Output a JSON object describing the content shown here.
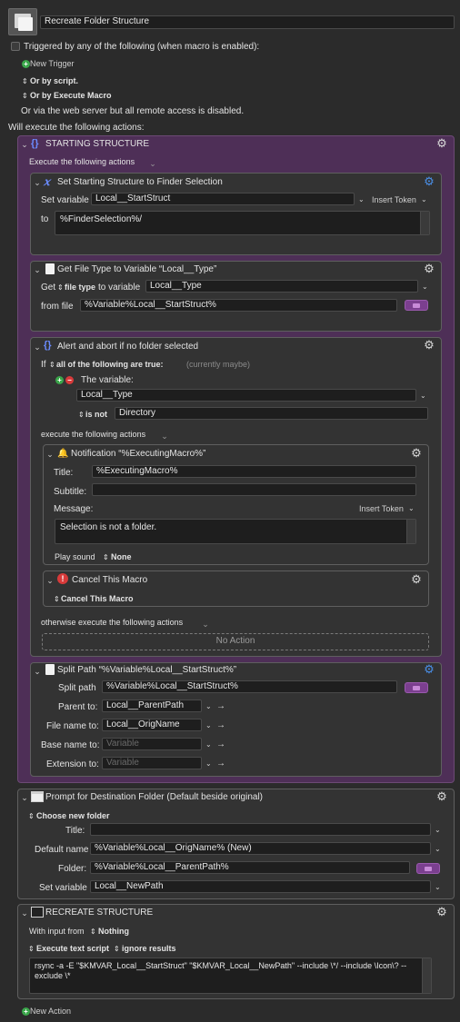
{
  "macro_name": "Recreate Folder Structure",
  "trigger": {
    "checkbox_label": "Triggered by any of the following (when macro is enabled):",
    "new_trigger": "New Trigger",
    "or_by_script": "Or by script.",
    "or_by_execute": "Or by Execute Macro",
    "web_server": "Or via the web server but all remote access is disabled."
  },
  "will_execute": "Will execute the following actions:",
  "group_starting": {
    "title": "STARTING STRUCTURE",
    "execute_label": "Execute the following actions"
  },
  "set_var": {
    "title": "Set Starting Structure to Finder Selection",
    "set_variable_label": "Set variable",
    "variable": "Local__StartStruct",
    "insert_token": "Insert Token",
    "to_label": "to",
    "value": "%FinderSelection%/"
  },
  "get_file_type": {
    "title": "Get File Type to Variable “Local__Type”",
    "get_label": "Get",
    "file_type": "file type",
    "to_variable_label": "to variable",
    "variable": "Local__Type",
    "from_file_label": "from file",
    "from_file": "%Variable%Local__StartStruct%"
  },
  "if_block": {
    "title": "Alert and abort if no folder selected",
    "if_label": "If",
    "condition": "all of the following are true:",
    "currently": "(currently maybe)",
    "the_variable_label": "The variable:",
    "variable": "Local__Type",
    "operator": "is not",
    "compare": "Directory",
    "execute_label": "execute the following actions",
    "otherwise_label": "otherwise execute the following actions",
    "no_action": "No Action"
  },
  "notification": {
    "title": "Notification “%ExecutingMacro%”",
    "title_label": "Title:",
    "title_value": "%ExecutingMacro%",
    "subtitle_label": "Subtitle:",
    "subtitle_value": "",
    "message_label": "Message:",
    "insert_token": "Insert Token",
    "message": "Selection is not a folder.",
    "play_sound_label": "Play sound",
    "play_sound": "None"
  },
  "cancel": {
    "title": "Cancel This Macro",
    "option": "Cancel This Macro"
  },
  "split_path": {
    "title": "Split Path “%Variable%Local__StartStruct%”",
    "split_path_label": "Split path",
    "split_path": "%Variable%Local__StartStruct%",
    "parent_label": "Parent to:",
    "parent": "Local__ParentPath",
    "filename_label": "File name to:",
    "filename": "Local__OrigName",
    "basename_label": "Base name to:",
    "basename_placeholder": "Variable",
    "extension_label": "Extension to:",
    "extension_placeholder": "Variable"
  },
  "prompt": {
    "title": "Prompt for Destination Folder (Default beside original)",
    "choose": "Choose new folder",
    "title_label": "Title:",
    "title_value": "",
    "default_name_label": "Default name",
    "default_name": "%Variable%Local__OrigName% (New)",
    "folder_label": "Folder:",
    "folder": "%Variable%Local__ParentPath%",
    "set_variable_label": "Set variable",
    "variable": "Local__NewPath"
  },
  "recreate": {
    "title": "RECREATE STRUCTURE",
    "with_input_label": "With input from",
    "with_input": "Nothing",
    "execute_script": "Execute text script",
    "ignore": "ignore results",
    "script": "rsync -a -E \"$KMVAR_Local__StartStruct\" \"$KMVAR_Local__NewPath\" --include \\*/ --include \\Icon\\? --exclude \\*"
  },
  "new_action": "New Action",
  "colors": {
    "background": "#2b2b2b",
    "group_purple": "#4e2f57",
    "accent_blue": "#4a8fe8",
    "add_green": "#3aa64a",
    "remove_red": "#d83a3a"
  }
}
